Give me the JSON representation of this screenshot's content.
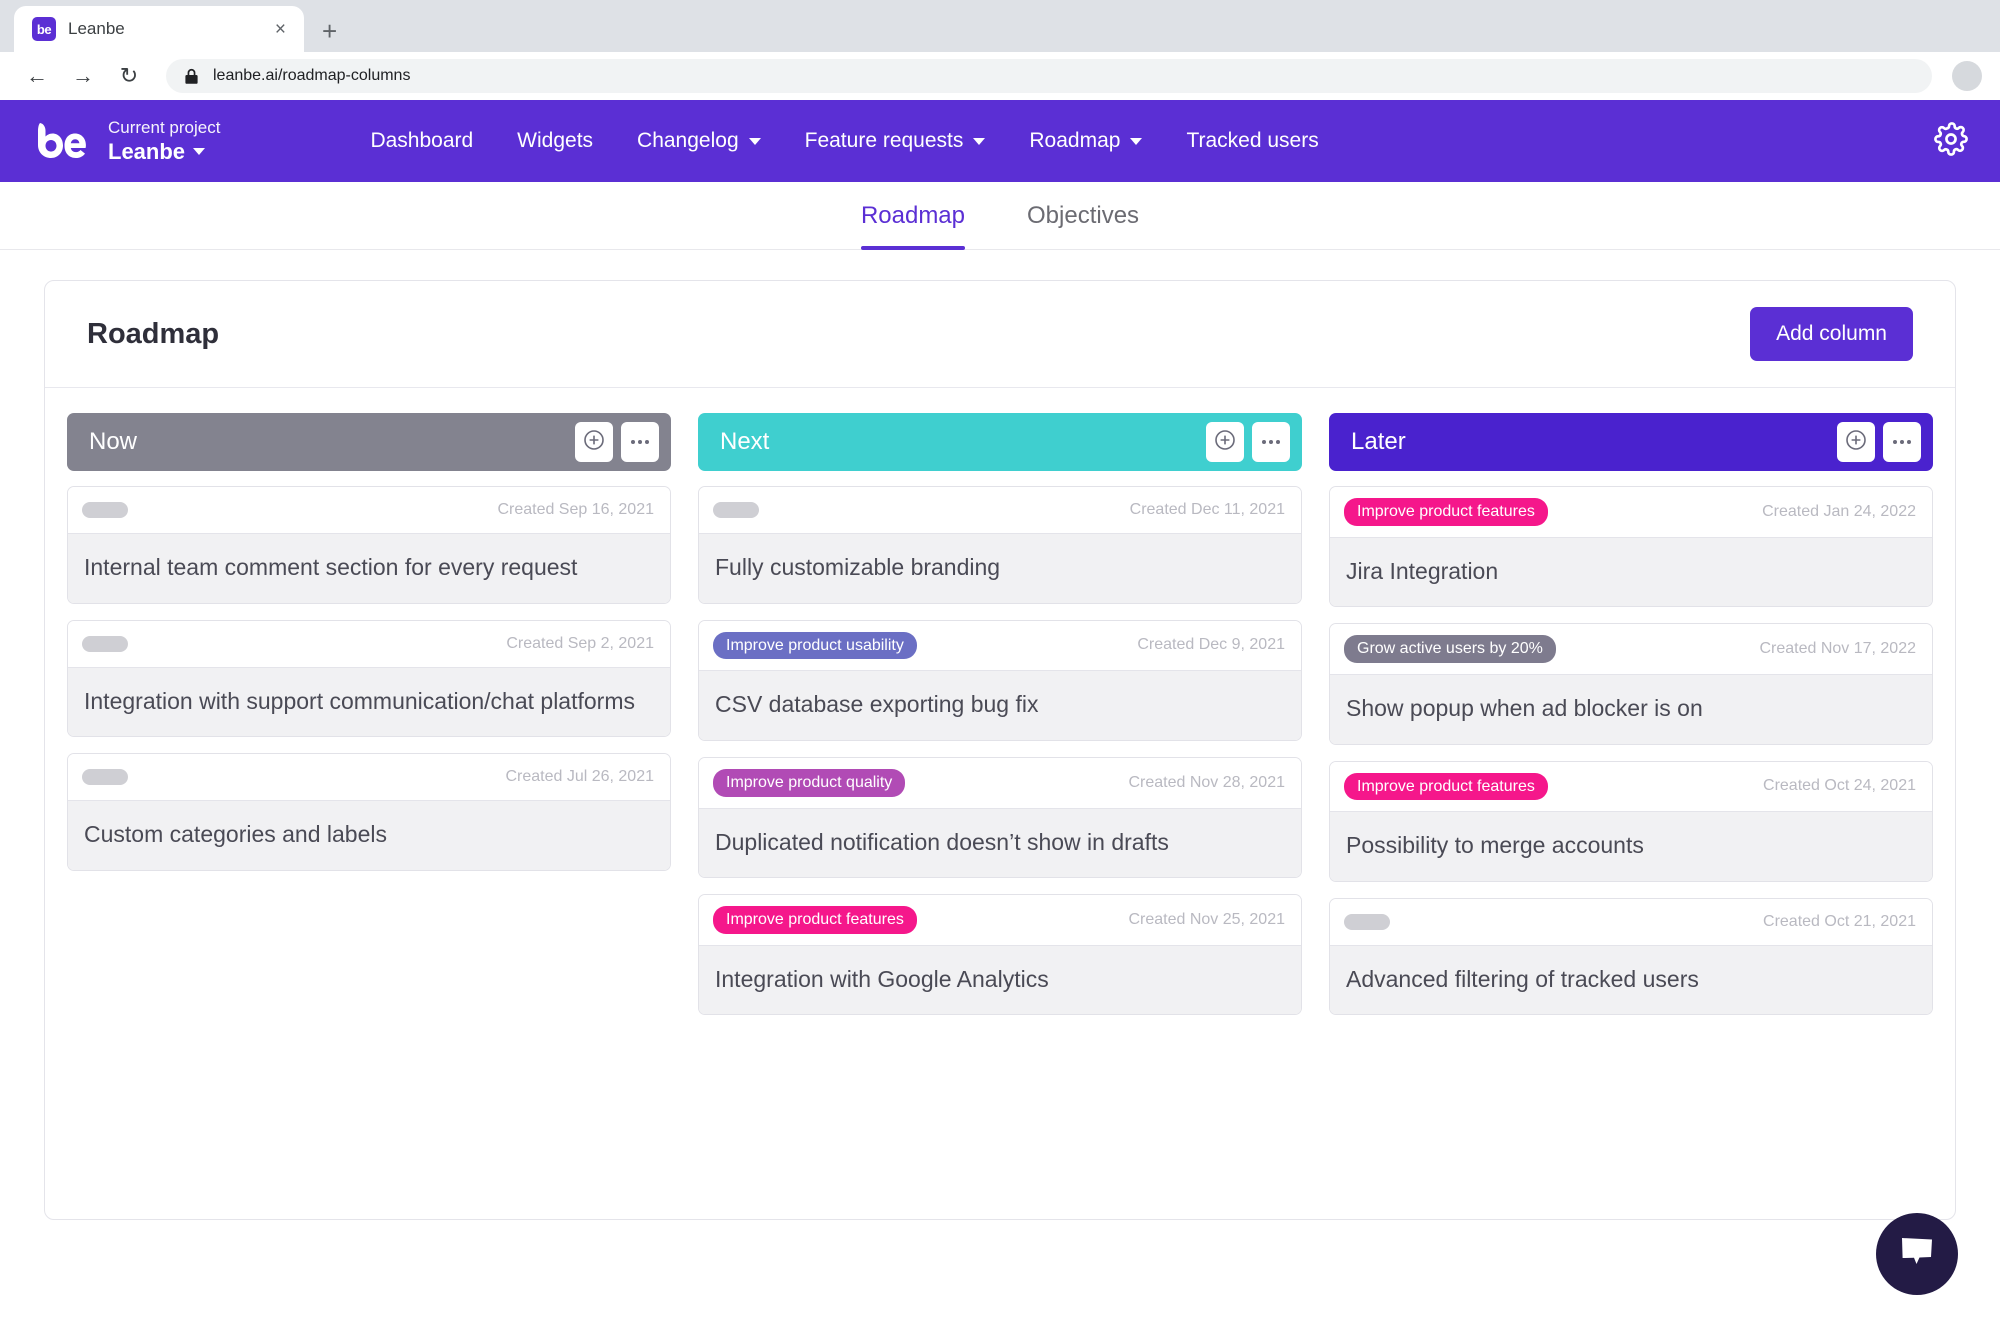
{
  "browser": {
    "tab_title": "Leanbe",
    "favicon_text": "be",
    "close_label": "×",
    "new_tab_label": "+",
    "back_label": "←",
    "forward_label": "→",
    "reload_label": "↻",
    "url": "leanbe.ai/roadmap-columns"
  },
  "header": {
    "logo_text": "be",
    "project_label": "Current project",
    "project_name": "Leanbe",
    "brand_color": "#5b2fd4",
    "nav": [
      {
        "label": "Dashboard",
        "has_caret": false
      },
      {
        "label": "Widgets",
        "has_caret": false
      },
      {
        "label": "Changelog",
        "has_caret": true
      },
      {
        "label": "Feature requests",
        "has_caret": true
      },
      {
        "label": "Roadmap",
        "has_caret": true
      },
      {
        "label": "Tracked users",
        "has_caret": false
      }
    ]
  },
  "subtabs": [
    {
      "label": "Roadmap",
      "active": true
    },
    {
      "label": "Objectives",
      "active": false
    }
  ],
  "panel": {
    "title": "Roadmap",
    "add_column_label": "Add column"
  },
  "board": {
    "columns": [
      {
        "name": "Now",
        "color": "#83838f",
        "cards": [
          {
            "tag": null,
            "tag_color": null,
            "date": "Created Sep 16, 2021",
            "title": "Internal team comment section for every request"
          },
          {
            "tag": null,
            "tag_color": null,
            "date": "Created Sep 2, 2021",
            "title": "Integration with support communication/chat platforms"
          },
          {
            "tag": null,
            "tag_color": null,
            "date": "Created Jul 26, 2021",
            "title": "Custom categories and labels"
          }
        ]
      },
      {
        "name": "Next",
        "color": "#3fcfcf",
        "cards": [
          {
            "tag": null,
            "tag_color": null,
            "date": "Created Dec 11, 2021",
            "title": "Fully customizable branding"
          },
          {
            "tag": "Improve product usability",
            "tag_color": "#6b6fc4",
            "date": "Created Dec 9, 2021",
            "title": "CSV database exporting bug fix"
          },
          {
            "tag": "Improve product quality",
            "tag_color": "#b14bb5",
            "date": "Created Nov 28, 2021",
            "title": "Duplicated notification doesn’t show in drafts"
          },
          {
            "tag": "Improve product features",
            "tag_color": "#f5178b",
            "date": "Created Nov 25, 2021",
            "title": "Integration with Google Analytics"
          }
        ]
      },
      {
        "name": "Later",
        "color": "#4a22ce",
        "cards": [
          {
            "tag": "Improve product features",
            "tag_color": "#f5178b",
            "date": "Created Jan 24, 2022",
            "title": "Jira Integration"
          },
          {
            "tag": "Grow active users by 20%",
            "tag_color": "#7e7b8e",
            "date": "Created Nov 17, 2022",
            "title": "Show popup when ad blocker is on"
          },
          {
            "tag": "Improve product features",
            "tag_color": "#f5178b",
            "date": "Created Oct 24, 2021",
            "title": "Possibility to merge accounts"
          },
          {
            "tag": null,
            "tag_color": null,
            "date": "Created Oct 21, 2021",
            "title": "Advanced filtering of tracked users"
          }
        ]
      }
    ]
  },
  "chat": {
    "icon": "chat-bubble-icon"
  }
}
